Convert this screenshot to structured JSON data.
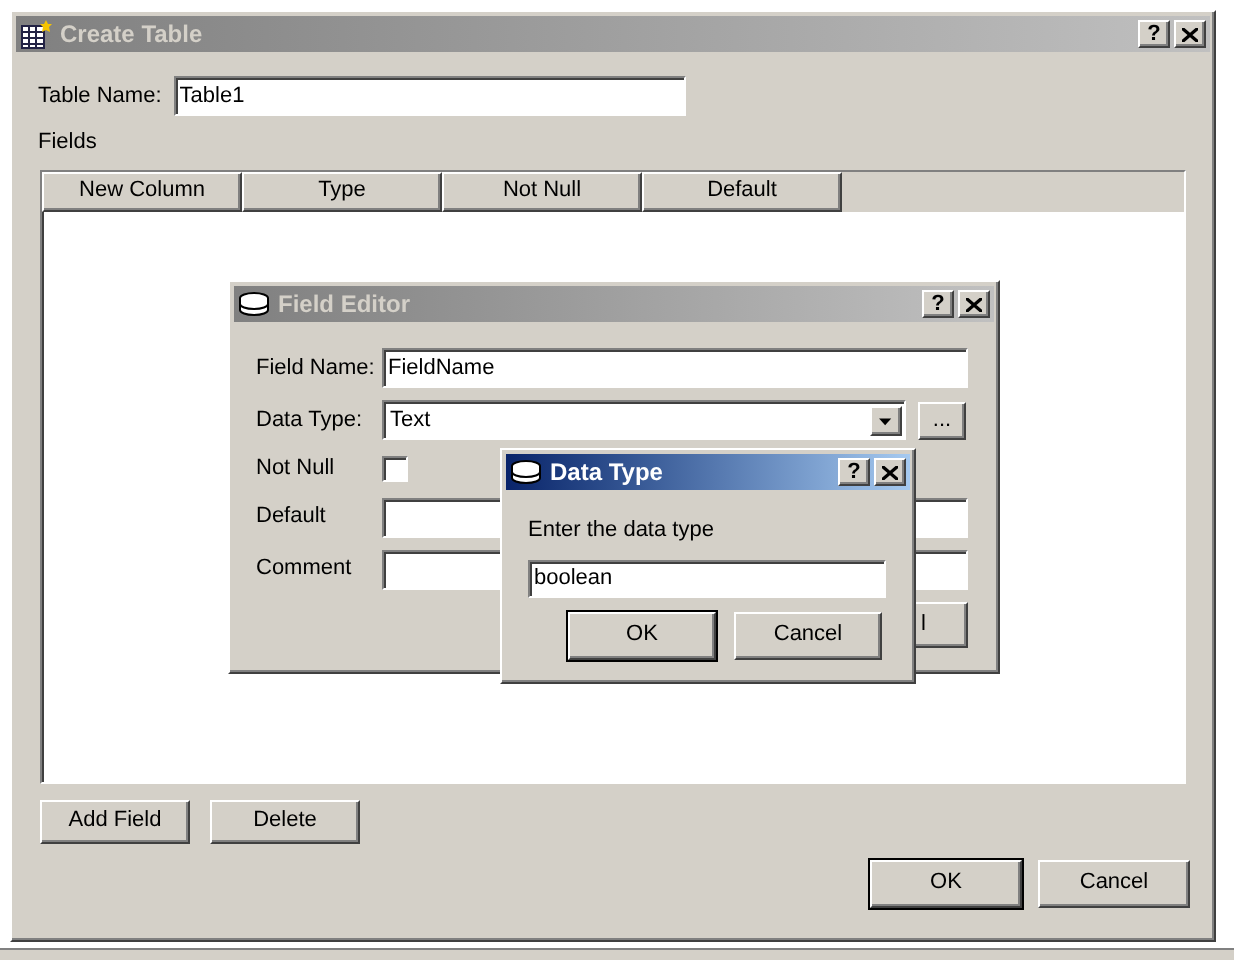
{
  "create_table": {
    "title": "Create Table",
    "help_glyph": "?",
    "table_name_label": "Table Name:",
    "table_name": "Table1",
    "fields_label": "Fields",
    "columns": [
      "New Column",
      "Type",
      "Not Null",
      "Default"
    ],
    "buttons": [
      "Add Field",
      "Delete"
    ],
    "footer_buttons": [
      "OK",
      "Cancel"
    ]
  },
  "field_editor": {
    "title": "Field Editor",
    "help_glyph": "?",
    "field_name_label": "Field Name:",
    "field_name": "FieldName",
    "data_type_label": "Data Type:",
    "data_type": "Text",
    "browse_button": "...",
    "not_null_label": "Not Null",
    "not_null_checked": false,
    "default_label": "Default",
    "comment_label": "Comment",
    "partial_button": "l"
  },
  "data_type_dialog": {
    "title": "Data Type",
    "help_glyph": "?",
    "prompt": "Enter the data type",
    "value": "boolean",
    "buttons": [
      "OK",
      "Cancel"
    ]
  }
}
